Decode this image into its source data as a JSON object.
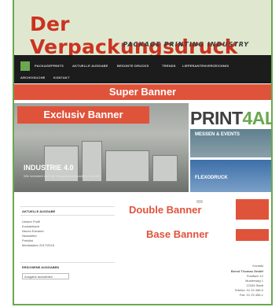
{
  "site": {
    "logo": "Der Verpackungsdruck",
    "tagline": "PACKAGE PRINTING INDUSTRY"
  },
  "nav": {
    "items": [
      "PACKAGEPRINTS",
      "AKTUELLE AUSGABE",
      "BESONTE DRUCKS",
      "TRENDS",
      "LIEFERANTENVERZEICHNIS",
      "ARCHIVSUCHE",
      "KONTAKT"
    ]
  },
  "banners": {
    "super": "Super Banner",
    "exclusiv": "Exclusiv Banner",
    "double": "Double Banner",
    "base": "Base Banner",
    "color": "#e0533b"
  },
  "hero": {
    "title": "INDUSTRIE 4.0",
    "subtitle": "Wie verändert sich die Verpackungsbranche in Zukunft"
  },
  "right": {
    "brand_a": "PRINT",
    "brand_b": "4AL",
    "tile1": "MESSEN & EVENTS",
    "tile2": "FLEXODRUCK"
  },
  "sidebar": {
    "section1": "AKTUELLE AUSGABE",
    "items": [
      "Unsere Profil",
      "Kontaktbuch",
      "Neues Extranet",
      "Newsletter",
      "Preislist",
      "Mediadaten 2017/2018"
    ],
    "section2": "ERSCHIENE AUSGABEN",
    "select_value": "Ausgabe auswählen"
  },
  "contact": {
    "lines": [
      "Kontakt",
      "Bernd Thomas GmbH",
      "Postfach 12",
      "Musterweg 1",
      "12345 Stadt",
      "Telefon: 01 23 456-0",
      "Fax: 01 23 456-1"
    ]
  },
  "colors": {
    "accent": "#e0533b",
    "brand_green": "#6aa84f",
    "header_bg": "#dfe8cf",
    "nav_bg": "#1c1c1c"
  }
}
